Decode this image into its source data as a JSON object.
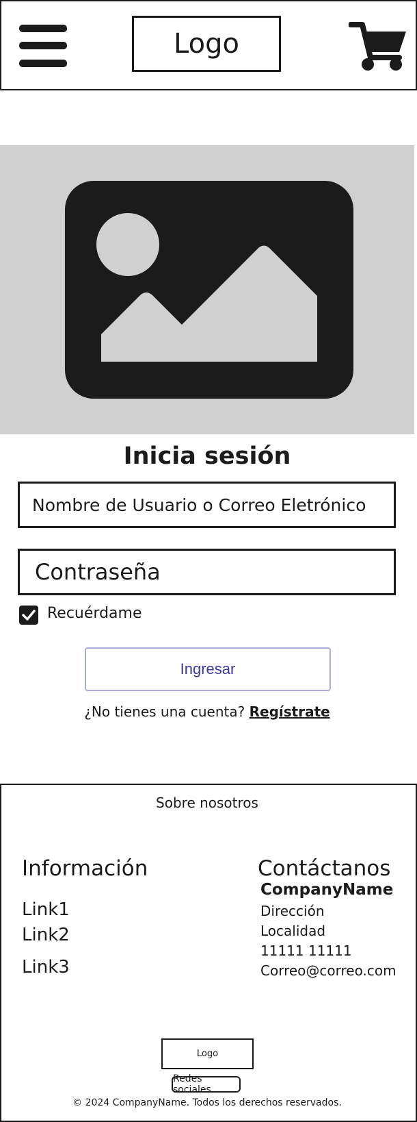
{
  "header": {
    "menu_icon": "hamburger-menu-icon",
    "logo_text": "Logo",
    "cart_icon": "shopping-cart-icon"
  },
  "hero": {
    "image_icon": "image-placeholder-icon"
  },
  "login": {
    "title": "Inicia sesión",
    "username_placeholder": "Nombre de Usuario o Correo Eletrónico",
    "password_placeholder": "Contraseña",
    "remember_label": "Recuérdame",
    "remember_checked": true,
    "submit_label": "Ingresar",
    "no_account_text": "¿No tienes una cuenta?",
    "signup_label": "Regístrate"
  },
  "footer": {
    "about_label": "Sobre nosotros",
    "info_title": "Información",
    "links": [
      "Link1",
      "Link2",
      "Link3"
    ],
    "contact_title": "Contáctanos",
    "company_name": "CompanyName",
    "address": "Dirección",
    "locality": "Localidad",
    "phone": "11111 11111",
    "email": "Correo@correo.com",
    "logo_text": "Logo",
    "social_label": "Redes sociales",
    "copyright": "© 2024 CompanyName. Todos los derechos reservados."
  },
  "colors": {
    "ink": "#1b1b1b",
    "placeholder_gray": "#d0d0d0",
    "button_text": "#3a3aa0",
    "button_border": "#a8acd6"
  }
}
